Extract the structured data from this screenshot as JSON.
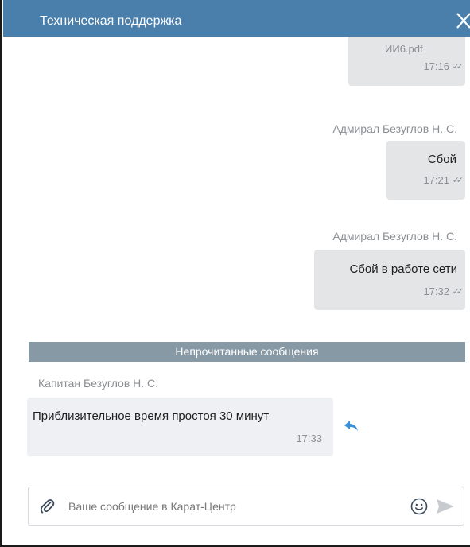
{
  "header": {
    "title": "Техническая поддержка",
    "close_icon": "close-icon"
  },
  "messages": [
    {
      "file": "ИИ6.pdf",
      "time": "17:16",
      "status_icon": "double-check-icon"
    },
    {
      "author": "Адмирал Безуглов Н. С.",
      "text": "Сбой",
      "time": "17:21",
      "status_icon": "double-check-icon"
    },
    {
      "author": "Адмирал Безуглов Н. С.",
      "text": "Сбой в работе сети",
      "time": "17:32",
      "status_icon": "double-check-icon"
    }
  ],
  "unread": {
    "label": "Непрочитанные сообщения"
  },
  "incoming": {
    "author": "Капитан Безуглов Н. С.",
    "text": "Приблизительное время простоя 30 минут",
    "time": "17:33",
    "reply_icon": "reply-icon"
  },
  "composer": {
    "placeholder": "Ваше сообщение в Карат-Центр",
    "attach_icon": "paperclip-icon",
    "emoji_icon": "smile-icon",
    "send_icon": "send-icon"
  },
  "colors": {
    "header": "#4a7fac",
    "unread_bar": "#8899a6",
    "bubble": "#e4e5e7"
  }
}
